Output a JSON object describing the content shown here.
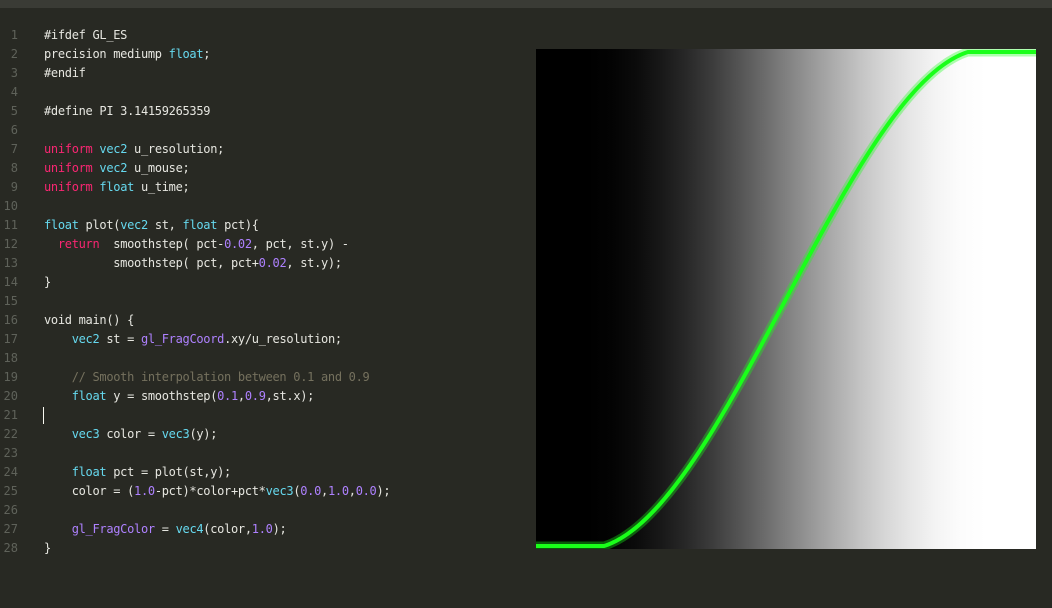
{
  "editor": {
    "lines": [
      {
        "num": "1",
        "tokens": [
          {
            "t": "#ifdef GL_ES",
            "c": "plain"
          }
        ]
      },
      {
        "num": "2",
        "tokens": [
          {
            "t": "precision mediump ",
            "c": "plain"
          },
          {
            "t": "float",
            "c": "type"
          },
          {
            "t": ";",
            "c": "plain"
          }
        ]
      },
      {
        "num": "3",
        "tokens": [
          {
            "t": "#endif",
            "c": "plain"
          }
        ]
      },
      {
        "num": "4",
        "tokens": []
      },
      {
        "num": "5",
        "tokens": [
          {
            "t": "#define PI 3.14159265359",
            "c": "plain"
          }
        ]
      },
      {
        "num": "6",
        "tokens": []
      },
      {
        "num": "7",
        "tokens": [
          {
            "t": "uniform",
            "c": "kw"
          },
          {
            "t": " ",
            "c": "plain"
          },
          {
            "t": "vec2",
            "c": "type"
          },
          {
            "t": " u_resolution;",
            "c": "plain"
          }
        ]
      },
      {
        "num": "8",
        "tokens": [
          {
            "t": "uniform",
            "c": "kw"
          },
          {
            "t": " ",
            "c": "plain"
          },
          {
            "t": "vec2",
            "c": "type"
          },
          {
            "t": " u_mouse;",
            "c": "plain"
          }
        ]
      },
      {
        "num": "9",
        "tokens": [
          {
            "t": "uniform",
            "c": "kw"
          },
          {
            "t": " ",
            "c": "plain"
          },
          {
            "t": "float",
            "c": "type"
          },
          {
            "t": " u_time;",
            "c": "plain"
          }
        ]
      },
      {
        "num": "10",
        "tokens": []
      },
      {
        "num": "11",
        "tokens": [
          {
            "t": "float",
            "c": "type"
          },
          {
            "t": " plot(",
            "c": "plain"
          },
          {
            "t": "vec2",
            "c": "type"
          },
          {
            "t": " st, ",
            "c": "plain"
          },
          {
            "t": "float",
            "c": "type"
          },
          {
            "t": " pct){",
            "c": "plain"
          }
        ]
      },
      {
        "num": "12",
        "tokens": [
          {
            "t": "  ",
            "c": "plain"
          },
          {
            "t": "return",
            "c": "kw"
          },
          {
            "t": "  smoothstep( pct-",
            "c": "plain"
          },
          {
            "t": "0.02",
            "c": "num"
          },
          {
            "t": ", pct, st.y) -",
            "c": "plain"
          }
        ]
      },
      {
        "num": "13",
        "tokens": [
          {
            "t": "          smoothstep( pct, pct+",
            "c": "plain"
          },
          {
            "t": "0.02",
            "c": "num"
          },
          {
            "t": ", st.y);",
            "c": "plain"
          }
        ]
      },
      {
        "num": "14",
        "tokens": [
          {
            "t": "}",
            "c": "plain"
          }
        ]
      },
      {
        "num": "15",
        "tokens": []
      },
      {
        "num": "16",
        "tokens": [
          {
            "t": "void main() {",
            "c": "plain"
          }
        ]
      },
      {
        "num": "17",
        "tokens": [
          {
            "t": "    ",
            "c": "plain"
          },
          {
            "t": "vec2",
            "c": "type"
          },
          {
            "t": " st = ",
            "c": "plain"
          },
          {
            "t": "gl_FragCoord",
            "c": "builtin"
          },
          {
            "t": ".xy/u_resolution;",
            "c": "plain"
          }
        ]
      },
      {
        "num": "18",
        "tokens": []
      },
      {
        "num": "19",
        "tokens": [
          {
            "t": "    // Smooth interpolation between 0.1 and 0.9",
            "c": "comment"
          }
        ]
      },
      {
        "num": "20",
        "tokens": [
          {
            "t": "    ",
            "c": "plain"
          },
          {
            "t": "float",
            "c": "type"
          },
          {
            "t": " y = smoothstep(",
            "c": "plain"
          },
          {
            "t": "0.1",
            "c": "num"
          },
          {
            "t": ",",
            "c": "plain"
          },
          {
            "t": "0.9",
            "c": "num"
          },
          {
            "t": ",st.x);",
            "c": "plain"
          }
        ]
      },
      {
        "num": "21",
        "tokens": []
      },
      {
        "num": "22",
        "tokens": [
          {
            "t": "    ",
            "c": "plain"
          },
          {
            "t": "vec3",
            "c": "type"
          },
          {
            "t": " color = ",
            "c": "plain"
          },
          {
            "t": "vec3",
            "c": "type"
          },
          {
            "t": "(y);",
            "c": "plain"
          }
        ]
      },
      {
        "num": "23",
        "tokens": []
      },
      {
        "num": "24",
        "tokens": [
          {
            "t": "    ",
            "c": "plain"
          },
          {
            "t": "float",
            "c": "type"
          },
          {
            "t": " pct = plot(st,y);",
            "c": "plain"
          }
        ]
      },
      {
        "num": "25",
        "tokens": [
          {
            "t": "    color = (",
            "c": "plain"
          },
          {
            "t": "1.0",
            "c": "num"
          },
          {
            "t": "-pct)*color+pct*",
            "c": "plain"
          },
          {
            "t": "vec3",
            "c": "type"
          },
          {
            "t": "(",
            "c": "plain"
          },
          {
            "t": "0.0",
            "c": "num"
          },
          {
            "t": ",",
            "c": "plain"
          },
          {
            "t": "1.0",
            "c": "num"
          },
          {
            "t": ",",
            "c": "plain"
          },
          {
            "t": "0.0",
            "c": "num"
          },
          {
            "t": ");",
            "c": "plain"
          }
        ]
      },
      {
        "num": "26",
        "tokens": []
      },
      {
        "num": "27",
        "tokens": [
          {
            "t": "    ",
            "c": "plain"
          },
          {
            "t": "gl_FragColor",
            "c": "builtin"
          },
          {
            "t": " = ",
            "c": "plain"
          },
          {
            "t": "vec4",
            "c": "type"
          },
          {
            "t": "(color,",
            "c": "plain"
          },
          {
            "t": "1.0",
            "c": "num"
          },
          {
            "t": ");",
            "c": "plain"
          }
        ]
      },
      {
        "num": "28",
        "tokens": [
          {
            "t": "}",
            "c": "plain"
          }
        ]
      }
    ],
    "cursor_line": "21"
  },
  "preview": {
    "curve_color": "#1aff1a",
    "gradient_dark": "#000000",
    "gradient_light": "#ffffff"
  },
  "colors": {
    "background": "#282923",
    "keyword": "#f92672",
    "type": "#66d9ef",
    "number": "#ae81ff",
    "comment": "#75715e",
    "text": "#e6e6e0",
    "gutter": "#5f625a"
  }
}
